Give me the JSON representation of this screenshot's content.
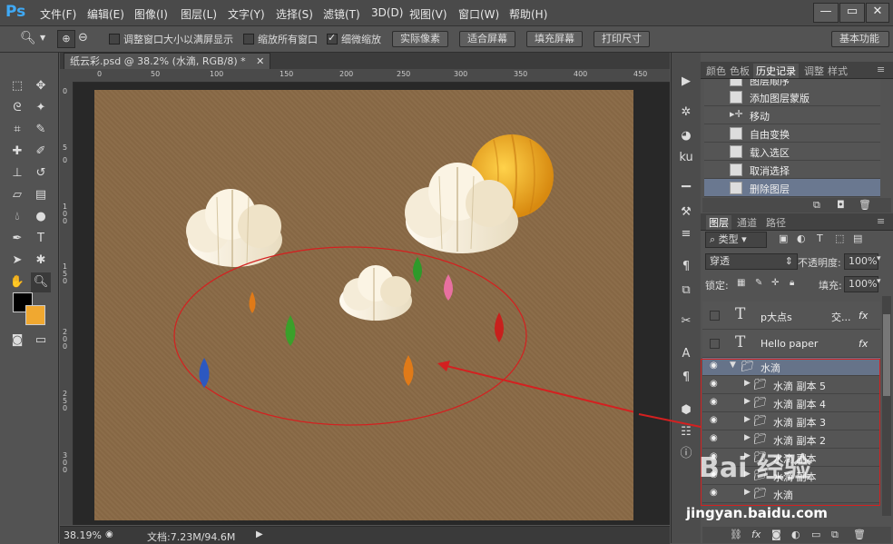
{
  "app": {
    "logo": "Ps"
  },
  "menu": [
    "文件(F)",
    "编辑(E)",
    "图像(I)",
    "图层(L)",
    "文字(Y)",
    "选择(S)",
    "滤镜(T)",
    "3D(D)",
    "视图(V)",
    "窗口(W)",
    "帮助(H)"
  ],
  "window_controls": {
    "minimize": "—",
    "restore": "▭",
    "close": "✕"
  },
  "options": {
    "cb_resize": "调整窗口大小以满屏显示",
    "cb_zoom_all": "缩放所有窗口",
    "cb_scrubby": "细微缩放",
    "btn_actual": "实际像素",
    "btn_fit": "适合屏幕",
    "btn_fill": "填充屏幕",
    "btn_print": "打印尺寸",
    "workspace": "基本功能"
  },
  "document": {
    "tab_title": "纸云彩.psd @ 38.2% (水滴, RGB/8) *",
    "ruler_h": [
      "0",
      "50",
      "100",
      "150",
      "200",
      "250",
      "300",
      "350",
      "400",
      "450"
    ],
    "ruler_v": [
      "0",
      "5",
      "0",
      "1 0 0",
      "1 5 0",
      "2 0 0",
      "2 5 0",
      "3 0 0"
    ],
    "paper_color": "#8a6a46"
  },
  "status": {
    "zoom": "38.19%",
    "doc": "文档:7.23M/94.6M"
  },
  "history": {
    "tabs": [
      "颜色",
      "色板",
      "历史记录",
      "调整",
      "样式"
    ],
    "active_tab": "历史记录",
    "items": [
      "图层顺序",
      "添加图层蒙版",
      "移动",
      "自由变换",
      "载入选区",
      "取消选择",
      "删除图层"
    ]
  },
  "layers": {
    "tabs": [
      "图层",
      "通道",
      "路径"
    ],
    "filter": "类型",
    "blend": "穿透",
    "opacity_label": "不透明度:",
    "opacity": "100%",
    "lock_label": "锁定:",
    "fill_label": "填充:",
    "fill": "100%",
    "rows": [
      {
        "name": "p大点s",
        "extra": "交...",
        "type": "text"
      },
      {
        "name": "Hello paper",
        "extra": "",
        "type": "text"
      },
      {
        "name": "水滴",
        "extra": "",
        "type": "group"
      },
      {
        "name": "水滴 副本 5",
        "extra": "",
        "type": "subgroup"
      },
      {
        "name": "水滴 副本 4",
        "extra": "",
        "type": "subgroup"
      },
      {
        "name": "水滴 副本 3",
        "extra": "",
        "type": "subgroup"
      },
      {
        "name": "水滴 副本 2",
        "extra": "",
        "type": "subgroup"
      },
      {
        "name": "水滴 副本",
        "extra": "",
        "type": "subgroup"
      },
      {
        "name": "水滴 副本",
        "extra": "",
        "type": "subgroup"
      },
      {
        "name": "水滴",
        "extra": "",
        "type": "subgroup"
      }
    ],
    "fx": "fx"
  },
  "watermark": {
    "text": "Bai 经验",
    "url": "jingyan.baidu.com"
  },
  "colors": {
    "highlight": "#667389",
    "annotation": "#d42020",
    "sun": "#f0a820"
  }
}
